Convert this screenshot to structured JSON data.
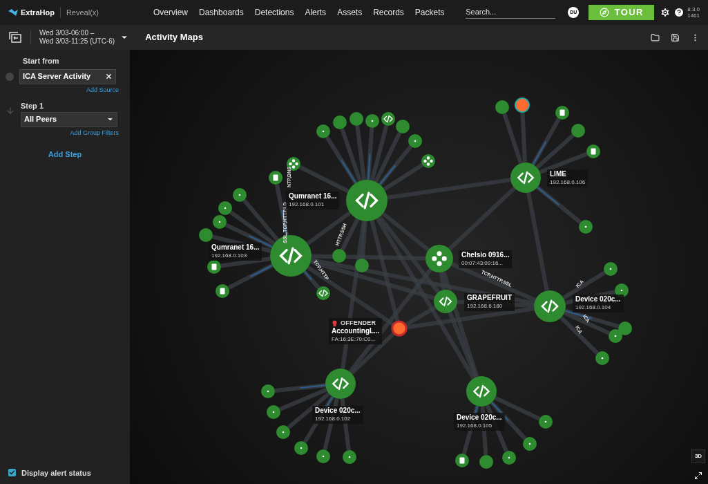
{
  "header": {
    "logo": "ExtraHop",
    "product": "Reveal(x)",
    "nav": [
      "Overview",
      "Dashboards",
      "Detections",
      "Alerts",
      "Assets",
      "Records",
      "Packets"
    ],
    "search": {
      "placeholder": "Search..."
    },
    "avatar": "DU",
    "tour": "TOUR",
    "version": [
      "8.3.0",
      "1461"
    ]
  },
  "toolbar": {
    "time_range": [
      "Wed 3/03-06:00 –",
      "Wed 3/03-11:25 (UTC-6)"
    ],
    "title": "Activity Maps"
  },
  "sidebar": {
    "start_label": "Start from",
    "source": "ICA Server Activity",
    "add_source": "Add Source",
    "step_label": "Step 1",
    "step_value": "All Peers",
    "add_filters": "Add Group Filters",
    "add_step": "Add Step",
    "alert_status": {
      "label": "Display alert status",
      "checked": true
    }
  },
  "map": {
    "nodes": [
      {
        "kind": "code",
        "name": "Qumranet 16...",
        "address": "192.168.0.101",
        "offender": false
      },
      {
        "kind": "code",
        "name": "Qumranet 16...",
        "address": "192.168.0.103",
        "offender": false
      },
      {
        "kind": "code",
        "name": "LIME",
        "address": "192.168.0.106",
        "offender": false
      },
      {
        "kind": "cluster",
        "name": "Chelsio 0916...",
        "address": "00:07:43:09:16...",
        "offender": false
      },
      {
        "kind": "code",
        "name": "GRAPEFRUIT",
        "address": "192.168.6.180",
        "offender": false
      },
      {
        "kind": "code",
        "name": "Device 020c...",
        "address": "192.168.0.104",
        "offender": false
      },
      {
        "kind": "alert",
        "name": "AccountingL...",
        "address": "FA:16:3E:70:C0...",
        "offender": true,
        "tag": "OFFENDER"
      },
      {
        "kind": "code",
        "name": "Device 020c...",
        "address": "192.168.0.102",
        "offender": false
      },
      {
        "kind": "code",
        "name": "Device 020c...",
        "address": "192.168.0.105",
        "offender": false
      }
    ],
    "protocol_labels": [
      "NTP,DNS",
      "SSL,TCP,HTTP,LD",
      "HTTP,SSH",
      "TCP,HTTP",
      "TCP,HTTP,SSL",
      "ICA",
      "ICA",
      "ICA"
    ]
  },
  "view_toggle": "3D"
}
